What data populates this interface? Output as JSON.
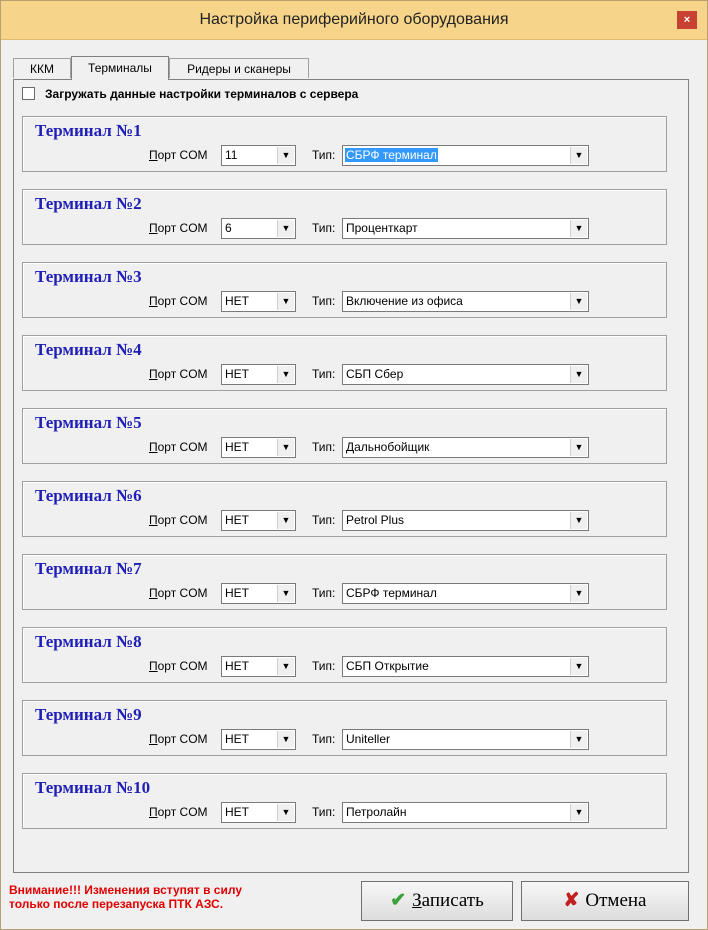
{
  "window": {
    "title": "Настройка периферийного оборудования",
    "close_label": "×"
  },
  "tabs": [
    {
      "label": "ККМ"
    },
    {
      "label": "Терминалы"
    },
    {
      "label": "Ридеры и сканеры"
    }
  ],
  "load_from_server": {
    "label": "Загружать данные настройки терминалов с сервера",
    "checked": false
  },
  "port_label_underlined": "П",
  "port_label_rest": "орт COM",
  "type_label": "Тип:",
  "terminals": [
    {
      "title": "Терминал №1",
      "port": "11",
      "type": "СБРФ терминал"
    },
    {
      "title": "Терминал №2",
      "port": "6",
      "type": "Проценткарт"
    },
    {
      "title": "Терминал №3",
      "port": "НЕТ",
      "type": "Включение из офиса"
    },
    {
      "title": "Терминал №4",
      "port": "НЕТ",
      "type": "СБП Сбер"
    },
    {
      "title": "Терминал №5",
      "port": "НЕТ",
      "type": "Дальнобойщик"
    },
    {
      "title": "Терминал №6",
      "port": "НЕТ",
      "type": "Petrol Plus"
    },
    {
      "title": "Терминал №7",
      "port": "НЕТ",
      "type": "СБРФ терминал"
    },
    {
      "title": "Терминал №8",
      "port": "НЕТ",
      "type": "СБП Открытие"
    },
    {
      "title": "Терминал №9",
      "port": "НЕТ",
      "type": "Uniteller"
    },
    {
      "title": "Терминал №10",
      "port": "НЕТ",
      "type": "Петролайн"
    }
  ],
  "warning": {
    "line1": "Внимание!!! Изменения вступят в силу",
    "line2": "только после перезапуска ПТК АЗС."
  },
  "buttons": {
    "save_underlined": "З",
    "save_rest": "аписать",
    "cancel": "Отмена"
  },
  "icons": {
    "save": "checkmark-icon",
    "cancel": "x-mark-icon",
    "dropdown": "down-arrow-icon"
  },
  "colors": {
    "titlebar": "#f6d58a",
    "close": "#c84032",
    "terminal_title": "#1f1fb8",
    "warning": "#e00000"
  }
}
